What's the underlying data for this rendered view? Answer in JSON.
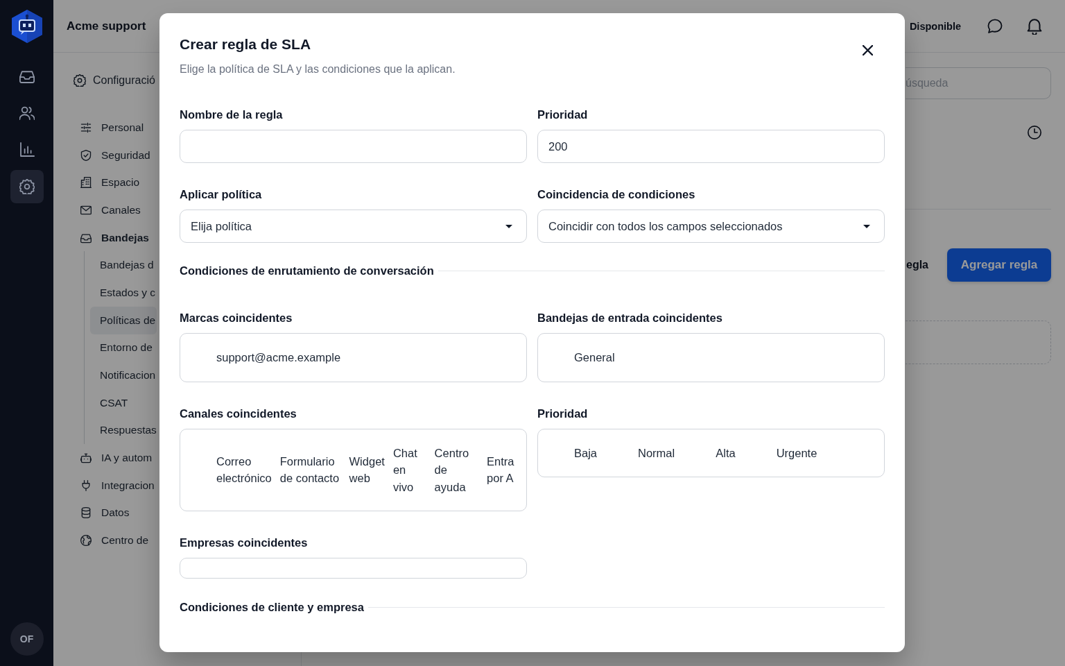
{
  "rail": {
    "items": [
      {
        "kind": "inbox",
        "selected": false
      },
      {
        "kind": "users",
        "selected": false
      },
      {
        "kind": "chart",
        "selected": false
      },
      {
        "kind": "settings",
        "selected": true
      }
    ],
    "avatar": {
      "initials": "OF"
    }
  },
  "header": {
    "workspace": "Acme support",
    "status": "Disponible"
  },
  "settings_nav": {
    "title": "Configuració",
    "items": [
      {
        "kind": "sliders",
        "label": "Personal",
        "selected": false
      },
      {
        "kind": "shield",
        "label": "Seguridad",
        "selected": false
      },
      {
        "kind": "building",
        "label": "Espacio",
        "selected": false
      },
      {
        "kind": "mail",
        "label": "Canales",
        "selected": false
      },
      {
        "kind": "inbox",
        "label": "Bandejas",
        "selected": false,
        "expanded": true,
        "children": [
          {
            "label": "Bandejas d",
            "selected": false
          },
          {
            "label": "Estados y c",
            "selected": false
          },
          {
            "label": "Políticas de",
            "selected": true
          },
          {
            "label": "Entorno de",
            "selected": false
          },
          {
            "label": "Notificacion",
            "selected": false
          },
          {
            "label": "CSAT",
            "selected": false
          },
          {
            "label": "Respuestas",
            "selected": false
          }
        ]
      },
      {
        "kind": "robot",
        "label": "IA y autom",
        "selected": false
      },
      {
        "kind": "plug",
        "label": "Integracion",
        "selected": false
      },
      {
        "kind": "database",
        "label": "Datos",
        "selected": false
      },
      {
        "kind": "globe",
        "label": "Centro de",
        "selected": false
      }
    ]
  },
  "content": {
    "search": {
      "placeholder": "úsqueda"
    },
    "heading": "egla",
    "add_button": "Agregar regla"
  },
  "modal": {
    "title": "Crear regla de SLA",
    "subtitle": "Elige la política de SLA y las condiciones que la aplican.",
    "fields": [
      {
        "kind": "text",
        "label": "Nombre de la regla"
      },
      {
        "kind": "text",
        "label": "Prioridad",
        "value": "200"
      },
      {
        "kind": "select",
        "label": "Aplicar política",
        "value": "Elija política"
      },
      {
        "kind": "select",
        "label": "Coincidencia de condiciones",
        "value": "Coincidir con todos los campos seleccionados"
      }
    ],
    "sections": [
      {
        "title": "Condiciones de enrutamiento de conversación",
        "fields": [
          {
            "kind": "checklist",
            "label": "Marcas coincidentes",
            "options": [
              "support@acme.example"
            ]
          },
          {
            "kind": "checklist",
            "label": "Bandejas de entrada coincidentes",
            "options": [
              "General"
            ]
          },
          {
            "kind": "checklist",
            "label": "Canales coincidentes",
            "options": [
              "Correo electrónico",
              "Formulario de contacto",
              "Widget web",
              "Chat en vivo",
              "Centro de ayuda",
              "Entra por A"
            ]
          },
          {
            "kind": "checklist",
            "label": "Prioridad",
            "options": [
              "Baja",
              "Normal",
              "Alta",
              "Urgente"
            ]
          },
          {
            "kind": "checklist",
            "label": "Empresas coincidentes"
          }
        ]
      },
      {
        "title": "Condiciones de cliente y empresa"
      }
    ]
  }
}
